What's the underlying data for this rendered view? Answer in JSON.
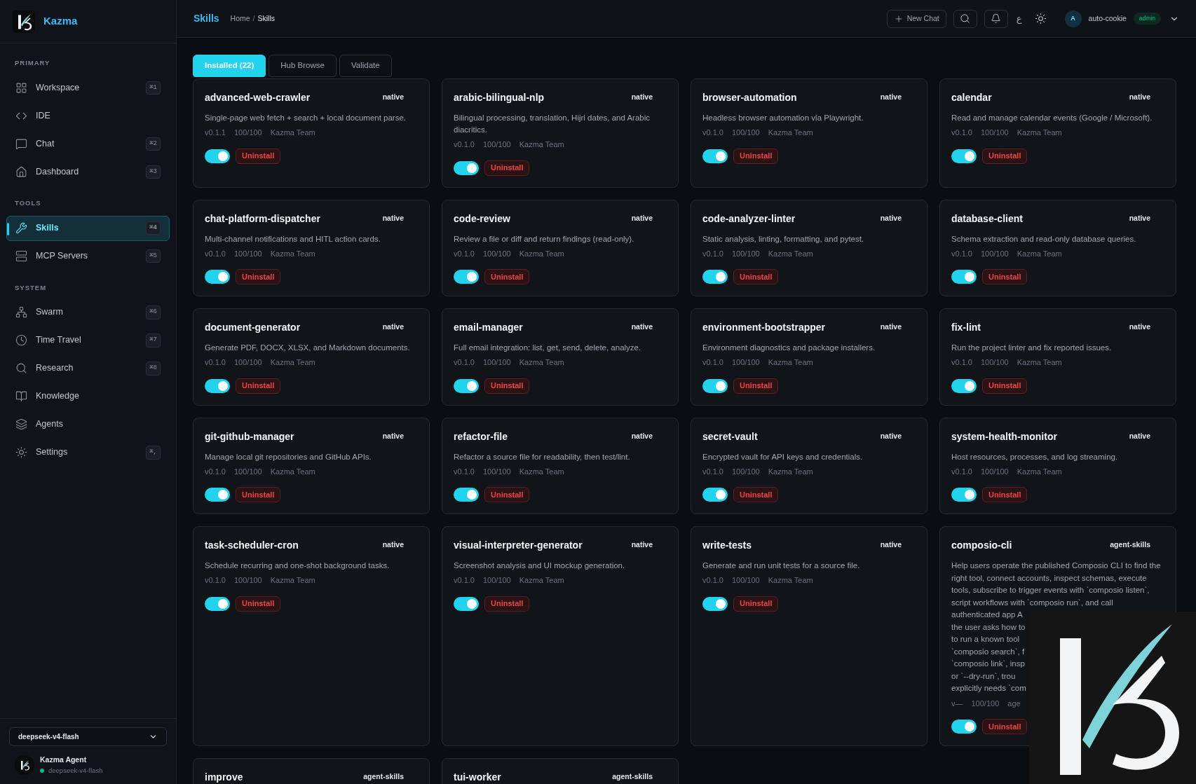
{
  "brand": {
    "name": "Kazma"
  },
  "sidebar": {
    "sections": [
      {
        "label": "PRIMARY",
        "items": [
          {
            "label": "Workspace",
            "shortcut": "⌘1",
            "selected": false
          },
          {
            "label": "IDE",
            "selected": false
          },
          {
            "label": "Chat",
            "shortcut": "⌘2",
            "selected": false
          },
          {
            "label": "Dashboard",
            "shortcut": "⌘3",
            "selected": false
          }
        ]
      },
      {
        "label": "TOOLS",
        "items": [
          {
            "label": "Skills",
            "shortcut": "⌘4",
            "selected": true
          },
          {
            "label": "MCP Servers",
            "shortcut": "⌘5",
            "selected": false
          }
        ]
      },
      {
        "label": "SYSTEM",
        "items": [
          {
            "label": "Swarm",
            "shortcut": "⌘6",
            "selected": false
          },
          {
            "label": "Time Travel",
            "shortcut": "⌘7",
            "selected": false
          },
          {
            "label": "Research",
            "shortcut": "⌘8",
            "selected": false
          },
          {
            "label": "Knowledge",
            "selected": false
          },
          {
            "label": "Agents",
            "selected": false
          },
          {
            "label": "Settings",
            "shortcut": "⌘,",
            "selected": false
          }
        ]
      }
    ],
    "model_select": {
      "value": "deepseek-v4-flash"
    },
    "agent": {
      "name": "Kazma Agent",
      "model": "deepseek-v4-flash",
      "online": true
    }
  },
  "header": {
    "title": "Skills",
    "breadcrumb": [
      "Home",
      "Skills"
    ],
    "breadcrumb_separator": "/",
    "new_chat": "New Chat",
    "language": "ع",
    "user": {
      "initial": "A",
      "name": "auto-cookie",
      "role": "admin"
    }
  },
  "tabs": [
    {
      "label": "Installed (22)",
      "selected": true
    },
    {
      "label": "Hub Browse",
      "selected": false
    },
    {
      "label": "Validate",
      "selected": false
    }
  ],
  "skills": [
    {
      "name": "advanced-web-crawler",
      "source": "native",
      "description": "Single-page web fetch + search + local document parse.",
      "version": "v0.1.1",
      "score": "100/100",
      "author": "Kazma Team",
      "on": true,
      "action": "Uninstall"
    },
    {
      "name": "arabic-bilingual-nlp",
      "source": "native",
      "description": "Bilingual processing, translation, Hijri dates, and Arabic diacritics.",
      "version": "v0.1.0",
      "score": "100/100",
      "author": "Kazma Team",
      "on": true,
      "action": "Uninstall"
    },
    {
      "name": "browser-automation",
      "source": "native",
      "description": "Headless browser automation via Playwright.",
      "version": "v0.1.0",
      "score": "100/100",
      "author": "Kazma Team",
      "on": true,
      "action": "Uninstall"
    },
    {
      "name": "calendar",
      "source": "native",
      "description": "Read and manage calendar events (Google / Microsoft).",
      "version": "v0.1.0",
      "score": "100/100",
      "author": "Kazma Team",
      "on": true,
      "action": "Uninstall"
    },
    {
      "name": "chat-platform-dispatcher",
      "source": "native",
      "description": "Multi-channel notifications and HITL action cards.",
      "version": "v0.1.0",
      "score": "100/100",
      "author": "Kazma Team",
      "on": true,
      "action": "Uninstall"
    },
    {
      "name": "code-review",
      "source": "native",
      "description": "Review a file or diff and return findings (read-only).",
      "version": "v0.1.0",
      "score": "100/100",
      "author": "Kazma Team",
      "on": true,
      "action": "Uninstall"
    },
    {
      "name": "code-analyzer-linter",
      "source": "native",
      "description": "Static analysis, linting, formatting, and pytest.",
      "version": "v0.1.0",
      "score": "100/100",
      "author": "Kazma Team",
      "on": true,
      "action": "Uninstall"
    },
    {
      "name": "database-client",
      "source": "native",
      "description": "Schema extraction and read-only database queries.",
      "version": "v0.1.0",
      "score": "100/100",
      "author": "Kazma Team",
      "on": true,
      "action": "Uninstall"
    },
    {
      "name": "document-generator",
      "source": "native",
      "description": "Generate PDF, DOCX, XLSX, and Markdown documents.",
      "version": "v0.1.0",
      "score": "100/100",
      "author": "Kazma Team",
      "on": true,
      "action": "Uninstall"
    },
    {
      "name": "email-manager",
      "source": "native",
      "description": "Full email integration: list, get, send, delete, analyze.",
      "version": "v0.1.0",
      "score": "100/100",
      "author": "Kazma Team",
      "on": true,
      "action": "Uninstall"
    },
    {
      "name": "environment-bootstrapper",
      "source": "native",
      "description": "Environment diagnostics and package installers.",
      "version": "v0.1.0",
      "score": "100/100",
      "author": "Kazma Team",
      "on": true,
      "action": "Uninstall"
    },
    {
      "name": "fix-lint",
      "source": "native",
      "description": "Run the project linter and fix reported issues.",
      "version": "v0.1.0",
      "score": "100/100",
      "author": "Kazma Team",
      "on": true,
      "action": "Uninstall"
    },
    {
      "name": "git-github-manager",
      "source": "native",
      "description": "Manage local git repositories and GitHub APIs.",
      "version": "v0.1.0",
      "score": "100/100",
      "author": "Kazma Team",
      "on": true,
      "action": "Uninstall"
    },
    {
      "name": "refactor-file",
      "source": "native",
      "description": "Refactor a source file for readability, then test/lint.",
      "version": "v0.1.0",
      "score": "100/100",
      "author": "Kazma Team",
      "on": true,
      "action": "Uninstall"
    },
    {
      "name": "secret-vault",
      "source": "native",
      "description": "Encrypted vault for API keys and credentials.",
      "version": "v0.1.0",
      "score": "100/100",
      "author": "Kazma Team",
      "on": true,
      "action": "Uninstall"
    },
    {
      "name": "system-health-monitor",
      "source": "native",
      "description": "Host resources, processes, and log streaming.",
      "version": "v0.1.0",
      "score": "100/100",
      "author": "Kazma Team",
      "on": true,
      "action": "Uninstall"
    },
    {
      "name": "task-scheduler-cron",
      "source": "native",
      "description": "Schedule recurring and one-shot background tasks.",
      "version": "v0.1.0",
      "score": "100/100",
      "author": "Kazma Team",
      "on": true,
      "action": "Uninstall"
    },
    {
      "name": "visual-interpreter-generator",
      "source": "native",
      "description": "Screenshot analysis and UI mockup generation.",
      "version": "v0.1.0",
      "score": "100/100",
      "author": "Kazma Team",
      "on": true,
      "action": "Uninstall"
    },
    {
      "name": "write-tests",
      "source": "native",
      "description": "Generate and run unit tests for a source file.",
      "version": "v0.1.0",
      "score": "100/100",
      "author": "Kazma Team",
      "on": true,
      "action": "Uninstall"
    },
    {
      "name": "composio-cli",
      "source": "agent-skills",
      "description_lines": [
        "Help users operate the published Composio CLI to find the",
        "right tool, connect accounts, inspect schemas, execute",
        "tools, subscribe to trigger events with `composio listen`,",
        "script workflows with `composio run`, and call",
        "authenticated app A",
        "the user asks how to",
        "to run a known tool",
        "`composio search`, f",
        "`composio link`, insp",
        "or `--dry-run`, trou",
        "explicitly needs `com"
      ],
      "version": "v—",
      "score": "100/100",
      "author": "age",
      "on": true,
      "action": "Uninstall"
    },
    {
      "name": "improve",
      "source": "agent-skills"
    },
    {
      "name": "tui-worker",
      "source": "agent-skills"
    }
  ]
}
